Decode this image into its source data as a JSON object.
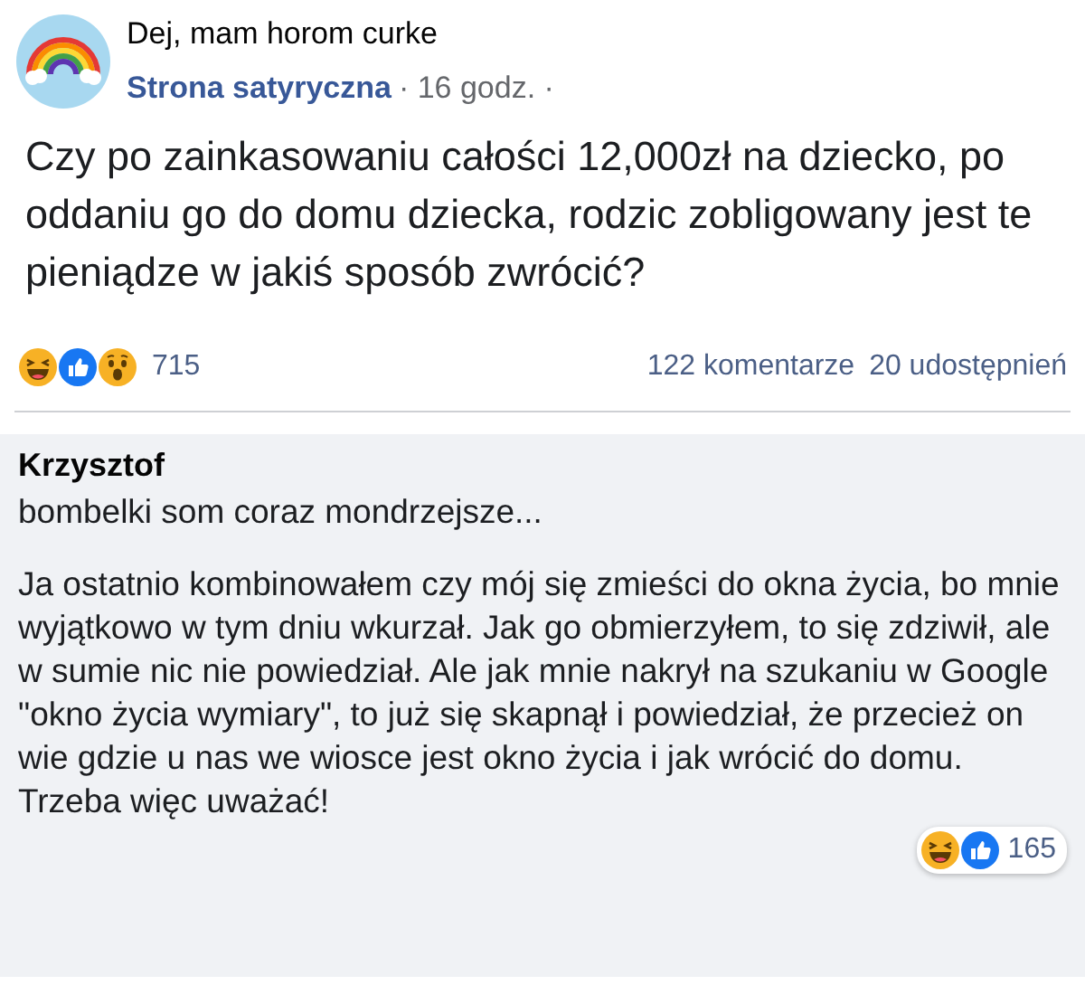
{
  "post": {
    "author": "Dej, mam horom curke",
    "page": "Strona satyryczna",
    "time": "· 16 godz. ·",
    "text": "Czy po zainkasowaniu całości 12,000zł na dziecko, po oddaniu go do domu dziecka, rodzic zobligowany jest te pieniądze w jakiś sposób zwrócić?"
  },
  "stats": {
    "reactions_count": "715",
    "comments": "122 komentarze",
    "shares": "20 udostępnień"
  },
  "comment": {
    "author": "Krzysztof",
    "paragraphs": [
      "bombelki som coraz mondrzejsze...",
      "Ja ostatnio kombinowałem czy mój się zmieści do okna życia, bo mnie wyjątkowo w tym dniu wkurzał. Jak go obmierzyłem, to się zdziwił, ale w sumie nic nie powiedział. Ale jak mnie nakrył na szukaniu w Google \"okno życia wymiary\", to już się skapnął i powiedział, że przecież on wie gdzie u nas we wiosce jest okno życia i jak wrócić do domu. Trzeba więc uważać!"
    ],
    "reactions_count": "165"
  }
}
